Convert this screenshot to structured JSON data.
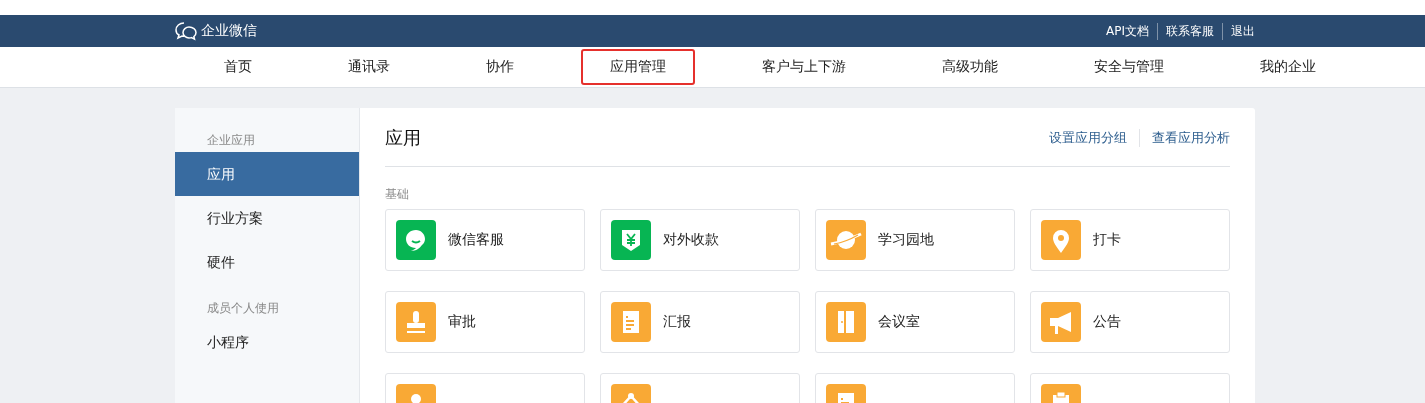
{
  "header": {
    "logo": "企业微信",
    "links": [
      "API文档",
      "联系客服",
      "退出"
    ]
  },
  "nav": [
    {
      "label": "首页",
      "selected": false
    },
    {
      "label": "通讯录",
      "selected": false
    },
    {
      "label": "协作",
      "selected": false
    },
    {
      "label": "应用管理",
      "selected": true
    },
    {
      "label": "客户与上下游",
      "selected": false
    },
    {
      "label": "高级功能",
      "selected": false
    },
    {
      "label": "安全与管理",
      "selected": false
    },
    {
      "label": "我的企业",
      "selected": false
    }
  ],
  "sidebar": [
    {
      "title": "企业应用",
      "items": [
        {
          "label": "应用",
          "selected": true
        },
        {
          "label": "行业方案",
          "selected": false
        },
        {
          "label": "硬件",
          "selected": false
        }
      ]
    },
    {
      "title": "成员个人使用",
      "items": [
        {
          "label": "小程序",
          "selected": false
        }
      ]
    }
  ],
  "main": {
    "title": "应用",
    "actions": [
      "设置应用分组",
      "查看应用分析"
    ],
    "section": "基础",
    "apps": [
      {
        "label": "微信客服",
        "color": "#07b553"
      },
      {
        "label": "对外收款",
        "color": "#07b553"
      },
      {
        "label": "学习园地",
        "color": "#f9a935"
      },
      {
        "label": "打卡",
        "color": "#f9a935"
      },
      {
        "label": "审批",
        "color": "#f9a935"
      },
      {
        "label": "汇报",
        "color": "#f9a935"
      },
      {
        "label": "会议室",
        "color": "#f9a935"
      },
      {
        "label": "公告",
        "color": "#f9a935"
      },
      {
        "color": "#f9a935"
      },
      {
        "color": "#f9a935"
      },
      {
        "color": "#f9a935"
      },
      {
        "color": "#f9a935"
      }
    ]
  }
}
